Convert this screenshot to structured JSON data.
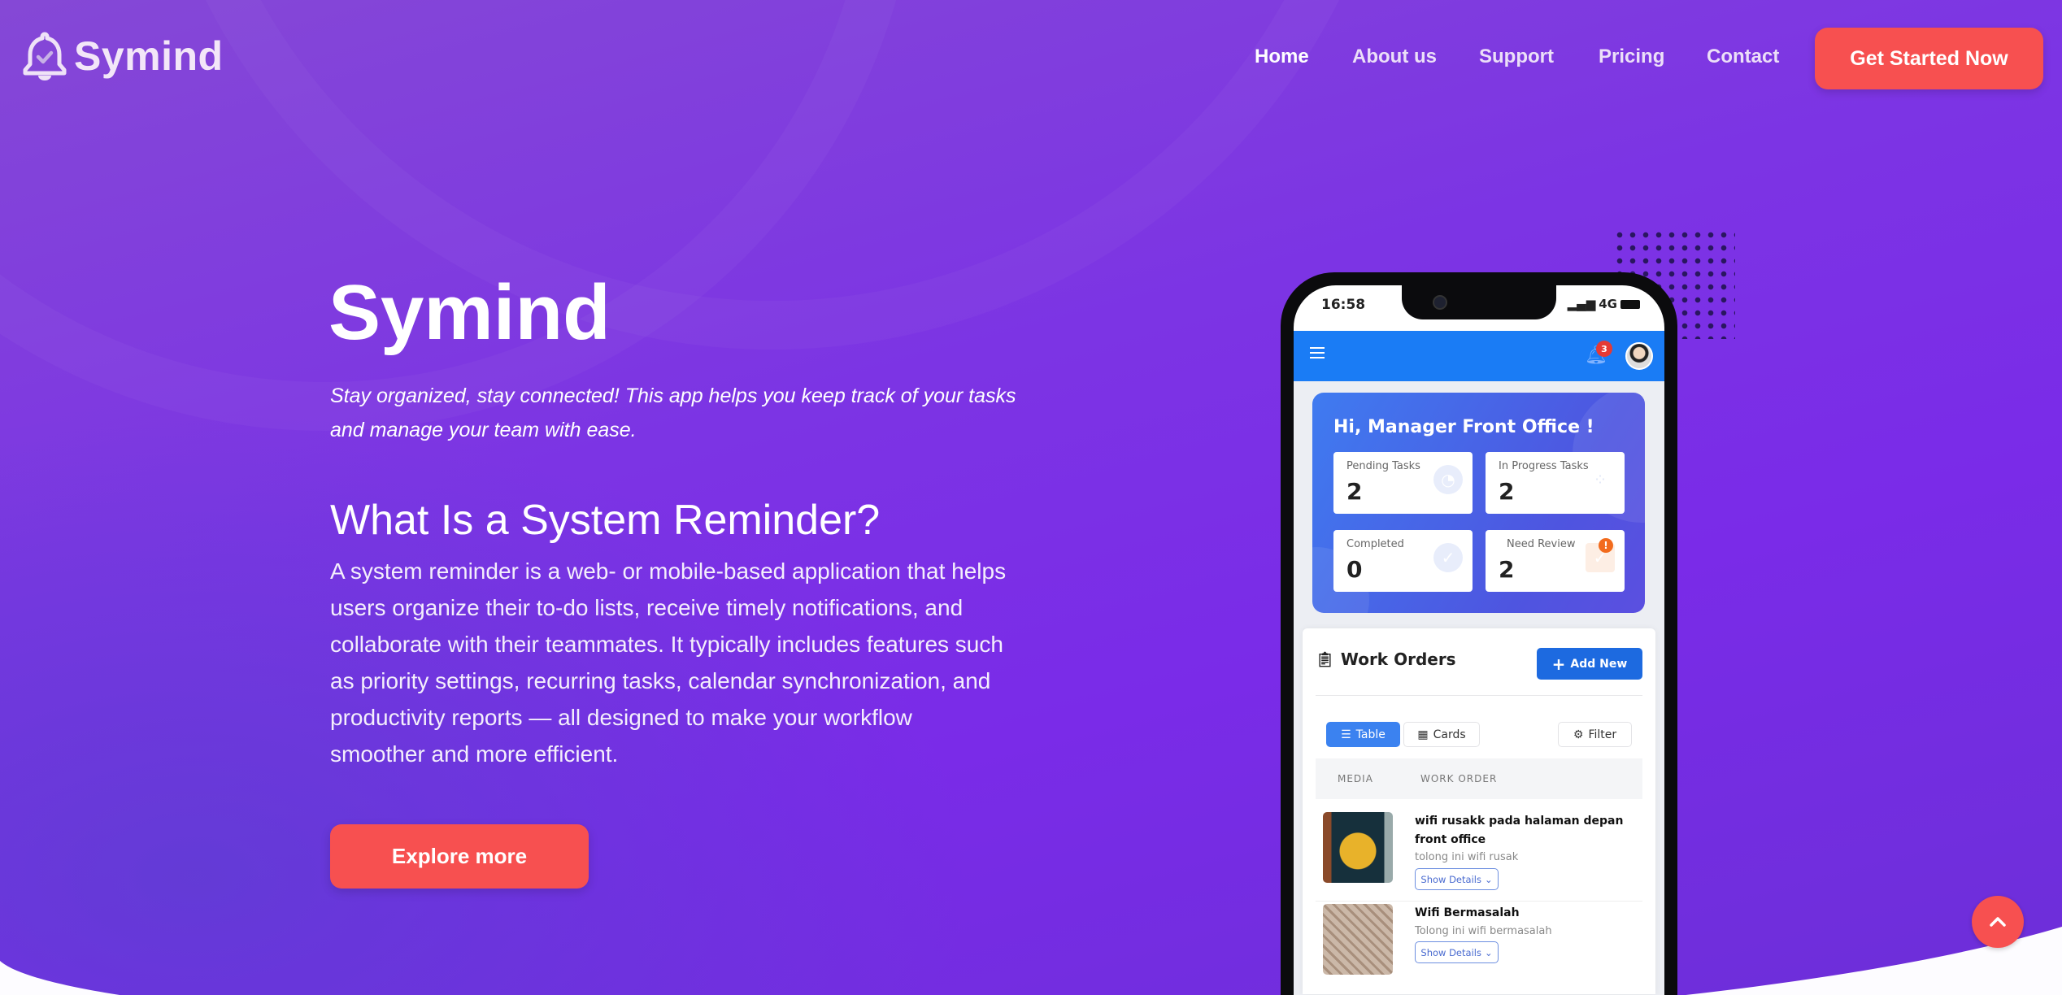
{
  "brand": {
    "name": "Symind",
    "accent": "#f75050"
  },
  "nav": {
    "items": [
      "Home",
      "About us",
      "Support",
      "Pricing",
      "Contact"
    ],
    "cta": "Get Started Now"
  },
  "hero": {
    "title": "Symind",
    "tagline": "Stay organized, stay connected! This app helps you keep track of your tasks and manage your team with ease.",
    "subtitle": "What Is a System Reminder?",
    "body": "A system reminder is a web- or mobile-based application that helps users organize their to-do lists, receive timely notifications, and collaborate with their teammates. It typically includes features such as priority settings, recurring tasks, calendar synchronization, and productivity reports — all designed to make your workflow smoother and more efficient.",
    "button": "Explore more"
  },
  "phone": {
    "time": "16:58",
    "network": "4G",
    "notifications": "3",
    "greeting": "Hi, Manager Front Office !",
    "stats": [
      {
        "label": "Pending Tasks",
        "value": "2"
      },
      {
        "label": "In Progress Tasks",
        "value": "2"
      },
      {
        "label": "Completed",
        "value": "0"
      },
      {
        "label": "Need Review",
        "value": "2",
        "badge": "!"
      }
    ],
    "work_orders": {
      "title": "Work Orders",
      "add_button": "Add New",
      "tabs": [
        "Table",
        "Cards"
      ],
      "filter": "Filter",
      "columns": [
        "MEDIA",
        "WORK ORDER"
      ],
      "rows": [
        {
          "title": "wifi rusakk pada halaman depan front office",
          "desc": "tolong ini wifi rusak",
          "action": "Show Details"
        },
        {
          "title": "Wifi Bermasalah",
          "desc": "Tolong ini wifi bermasalah",
          "action": "Show Details"
        }
      ]
    }
  }
}
